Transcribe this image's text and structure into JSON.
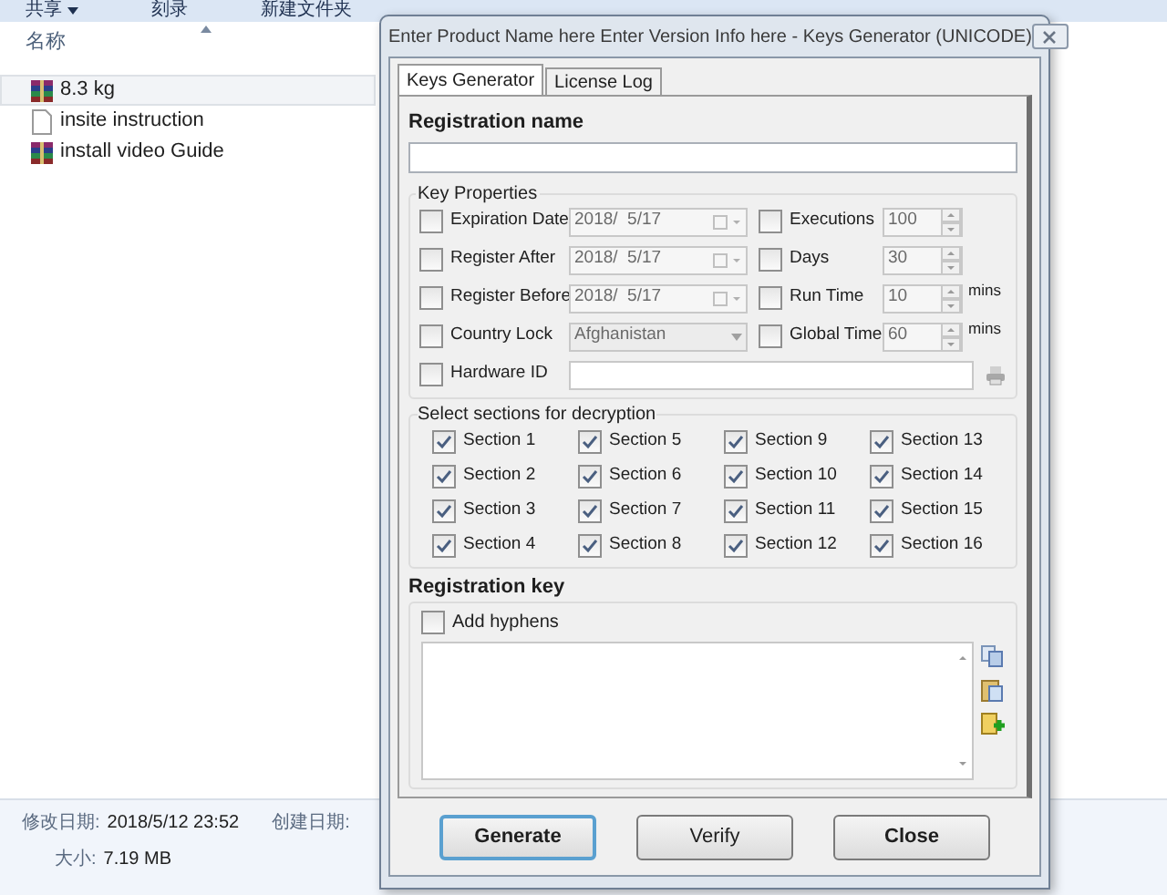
{
  "explorer": {
    "toolbar": [
      {
        "label": "共享",
        "kind": "menu"
      },
      {
        "label": "刻录",
        "kind": "button"
      },
      {
        "label": "新建文件夹",
        "kind": "button"
      }
    ],
    "column_header": "名称",
    "files": [
      {
        "name": "8.3 kg",
        "kind": "archive",
        "selected": true
      },
      {
        "name": "insite instruction",
        "kind": "document",
        "selected": false
      },
      {
        "name": "install video Guide",
        "kind": "archive",
        "selected": false
      }
    ],
    "details": [
      {
        "label": "修改日期:",
        "value": "2018/5/12 23:52"
      },
      {
        "label": "创建日期:"
      }
    ],
    "size": {
      "label": "大小:",
      "value": "7.19 MB"
    }
  },
  "dialog": {
    "title": "Enter Product Name here Enter Version Info here - Keys Generator (UNICODE)",
    "tabs": [
      {
        "label": "Keys Generator",
        "selected": true
      },
      {
        "label": "License Log",
        "selected": false
      }
    ],
    "registration_name": {
      "label": "Registration name"
    },
    "key_properties": {
      "title": "Key Properties",
      "left": [
        {
          "label": "Expiration Date",
          "checked": false,
          "kind": "date",
          "value": "2018/  5/17"
        },
        {
          "label": "Register After",
          "checked": false,
          "kind": "date",
          "value": "2018/  5/17"
        },
        {
          "label": "Register Before",
          "checked": false,
          "kind": "date",
          "value": "2018/  5/17"
        },
        {
          "label": "Country Lock",
          "checked": false,
          "kind": "combo",
          "value": "Afghanistan"
        },
        {
          "label": "Hardware ID",
          "checked": false,
          "kind": "text"
        }
      ],
      "right": [
        {
          "label": "Executions",
          "checked": false,
          "value": "100"
        },
        {
          "label": "Days",
          "checked": false,
          "value": "30"
        },
        {
          "label": "Run Time",
          "checked": false,
          "value": "10",
          "unit": "mins"
        },
        {
          "label": "Global Time",
          "checked": false,
          "value": "60",
          "unit": "mins"
        }
      ]
    },
    "sections": {
      "title": "Select sections for decryption",
      "items": [
        {
          "label": "Section 1",
          "checked": true
        },
        {
          "label": "Section 2",
          "checked": true
        },
        {
          "label": "Section 3",
          "checked": true
        },
        {
          "label": "Section 4",
          "checked": true
        },
        {
          "label": "Section 5",
          "checked": true
        },
        {
          "label": "Section 6",
          "checked": true
        },
        {
          "label": "Section 7",
          "checked": true
        },
        {
          "label": "Section 8",
          "checked": true
        },
        {
          "label": "Section 9",
          "checked": true
        },
        {
          "label": "Section 10",
          "checked": true
        },
        {
          "label": "Section 11",
          "checked": true
        },
        {
          "label": "Section 12",
          "checked": true
        },
        {
          "label": "Section 13",
          "checked": true
        },
        {
          "label": "Section 14",
          "checked": true
        },
        {
          "label": "Section 15",
          "checked": true
        },
        {
          "label": "Section 16",
          "checked": true
        }
      ]
    },
    "registration_key": {
      "label": "Registration key",
      "add_hyphens": {
        "label": "Add hyphens",
        "checked": false
      }
    },
    "buttons": [
      {
        "label": "Generate",
        "default": true
      },
      {
        "label": "Verify",
        "default": false
      },
      {
        "label": "Close",
        "default": false
      }
    ]
  }
}
